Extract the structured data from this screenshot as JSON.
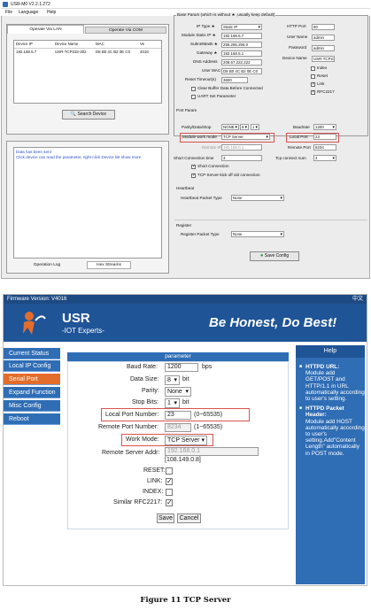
{
  "app": {
    "title": "USR-M0 V2.2.1.272",
    "menu": [
      "File",
      "Language",
      "Help"
    ]
  },
  "left_panel": {
    "tab_lan": "Operate Via LAN",
    "tab_com": "Operate Via COM",
    "columns": [
      "Device IP",
      "Device Name",
      "MAC",
      "Ve"
    ],
    "row": [
      "192.168.5.7",
      "USR-TCP232-302",
      "D8 B0 4C B2 0E C0",
      "4016"
    ],
    "search_button": "Search Device",
    "log_text": "Data has been sent\nClick device can read the parameter, right-click Device list show more",
    "tab_log": "Operation Log",
    "tab_stream": "Hex Streams"
  },
  "base_param": {
    "title": "Base Param (which is without ★ ,usually keep default)",
    "ip_type_label": "IP Type ★",
    "ip_type": "Static IP",
    "ip_label": "Module Static IP ★",
    "ip": "192.168.5.7",
    "mask_label": "SubnetMask ★",
    "mask": "255.255.255.0",
    "gateway_label": "Gateway ★",
    "gateway": "192.168.5.1",
    "dns_label": "DNS Address",
    "dns": "208.67.222.222",
    "mac_label": "User MAC",
    "mac": "D8 B0 4C B2 0E C0",
    "reset_label": "Reset Timeout(s)",
    "reset": "3600",
    "clear_buffer": "Clear Buffer Data Before Connected",
    "uart_set": "UART Set Parameter",
    "http_label": "HTTP Port",
    "http": "80",
    "user_label": "User Name",
    "user": "admin",
    "pass_label": "Password",
    "pass": "admin",
    "devname_label": "Device Name",
    "devname": "USR-TCP232",
    "index": "Index",
    "reset_cb": "Reset",
    "link": "Link",
    "rfc": "RFC2217"
  },
  "port_param": {
    "title": "Port Param",
    "parity_label": "Parity/Data/Stop",
    "parity": "NONE",
    "data": "8",
    "stop": "1",
    "baud_label": "Baudrate",
    "baud": "1200",
    "mode_label": "Module work mode",
    "mode": "TCP Server",
    "local_label": "Local Port",
    "local": "23",
    "remote_ip_label": "Remote IP",
    "remote_ip": "192.168.0.1",
    "remote_port_label": "Remote Port",
    "remote_port": "8234",
    "short_label": "Short Connection time",
    "short": "3",
    "tcp_num_label": "Tcp connect num",
    "tcp_num": "4",
    "short_cb": "Short Connection",
    "kick_cb": "TCP Server-kick off old connection"
  },
  "heartbeat": {
    "title": "Heartbeat",
    "label": "Heartbeat Packet Type",
    "value": "None"
  },
  "register": {
    "title": "Register",
    "label": "Register Packet Type",
    "value": "None"
  },
  "save_config": "Save Config",
  "web": {
    "firmware": "Firmware Version:  V4016",
    "lang": "中文",
    "logo": "USR",
    "logo_sub": "-IOT Experts-",
    "slogan": "Be Honest, Do Best!",
    "nav": [
      "Current Status",
      "Local IP Config",
      "Serial Port",
      "Expand Function",
      "Misc Config",
      "Reboot"
    ],
    "param_title": "parameter",
    "help_title": "Help",
    "baud_label": "Baud Rate:",
    "baud": "1200",
    "baud_unit": "bps",
    "data_label": "Data Size:",
    "data": "8",
    "data_unit": "bit",
    "parity_label": "Parity:",
    "parity": "None",
    "stop_label": "Stop Bits:",
    "stop": "1",
    "stop_unit": "bit",
    "local_label": "Local Port Number:",
    "local": "23",
    "local_hint": "(0~65535)",
    "remote_port_label": "Remote Port Number:",
    "remote_port": "8234",
    "remote_hint": "(1~65535)",
    "mode_label": "Work Mode:",
    "mode": "TCP Server",
    "remote_addr_label": "Remote Server Addr:",
    "remote_addr": "192.168.0.1",
    "remote_addr2": "[108.149.0.8]",
    "reset_label": "RESET:",
    "link_label": "LINK:",
    "index_label": "INDEX:",
    "rfc_label": "Similar RFC2217:",
    "save": "Save",
    "cancel": "Cancel",
    "help1_title": "HTTPD URL:",
    "help1": "Module add GET/POST and HTTP/1.1 in URL automatically according to user's setting.",
    "help2_title": "HTTPD Packet Header:",
    "help2": "Module add HOST automatically according to user's setting.Add\"Content Length\" automatically in POST mode."
  },
  "caption": "Figure 11 TCP Server",
  "colors": {
    "accent": "#2f6db5",
    "active": "#e36d2a",
    "highlight": "#d9534f",
    "header": "#1e4a83"
  }
}
